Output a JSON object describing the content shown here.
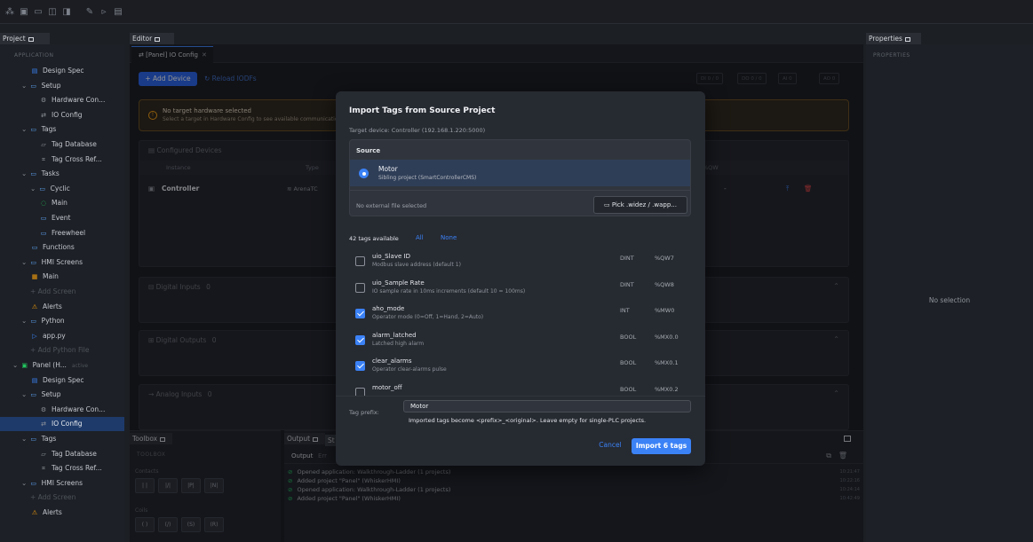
{
  "toolbar": {
    "icons": [
      "sitemap-icon",
      "new-panel-icon",
      "folder-icon",
      "save-icon",
      "save-all-icon",
      "wrench-icon",
      "run-icon",
      "window-icon"
    ]
  },
  "project": {
    "tab": "Project",
    "section": "APPLICATION",
    "tree": [
      {
        "label": "Design Spec",
        "icon": "document-icon",
        "indent": 2
      },
      {
        "label": "Setup",
        "icon": "folder-icon",
        "indent": 1,
        "chev": true
      },
      {
        "label": "Hardware Con...",
        "icon": "gear-icon",
        "indent": 3
      },
      {
        "label": "IO Config",
        "icon": "io-icon",
        "indent": 3
      },
      {
        "label": "Tags",
        "icon": "folder-icon",
        "indent": 1,
        "chev": true
      },
      {
        "label": "Tag Database",
        "icon": "tag-icon",
        "indent": 3
      },
      {
        "label": "Tag Cross Ref...",
        "icon": "crossref-icon",
        "indent": 3
      },
      {
        "label": "Tasks",
        "icon": "folder-icon",
        "indent": 1,
        "chev": true
      },
      {
        "label": "Cyclic",
        "icon": "folder-icon",
        "indent": 2,
        "chev": true
      },
      {
        "label": "Main",
        "icon": "cyclic-icon",
        "indent": 3
      },
      {
        "label": "Event",
        "icon": "folder-icon",
        "indent": 3
      },
      {
        "label": "Freewheel",
        "icon": "folder-icon",
        "indent": 3
      },
      {
        "label": "Functions",
        "icon": "folder-icon",
        "indent": 2
      },
      {
        "label": "HMI Screens",
        "icon": "folder-icon",
        "indent": 1,
        "chev": true
      },
      {
        "label": "Main",
        "icon": "screen-icon",
        "indent": 2
      },
      {
        "label": "+ Add Screen",
        "icon": "",
        "indent": 2,
        "dim": true
      },
      {
        "label": "Alerts",
        "icon": "warning-icon",
        "indent": 2
      },
      {
        "label": "Python",
        "icon": "folder-icon",
        "indent": 1,
        "chev": true
      },
      {
        "label": "app.py",
        "icon": "python-icon",
        "indent": 2
      },
      {
        "label": "+ Add Python File",
        "icon": "",
        "indent": 2,
        "dim": true
      },
      {
        "label": "Panel (H...",
        "icon": "project-icon",
        "indent": 0,
        "chev": true,
        "badge": "active"
      },
      {
        "label": "Design Spec",
        "icon": "document-icon",
        "indent": 2
      },
      {
        "label": "Setup",
        "icon": "folder-icon",
        "indent": 1,
        "chev": true
      },
      {
        "label": "Hardware Con...",
        "icon": "gear-icon",
        "indent": 3
      },
      {
        "label": "IO Config",
        "icon": "io-icon",
        "indent": 3,
        "selected": true
      },
      {
        "label": "Tags",
        "icon": "folder-icon",
        "indent": 1,
        "chev": true
      },
      {
        "label": "Tag Database",
        "icon": "tag-icon",
        "indent": 3
      },
      {
        "label": "Tag Cross Ref...",
        "icon": "crossref-icon",
        "indent": 3
      },
      {
        "label": "HMI Screens",
        "icon": "folder-icon",
        "indent": 1,
        "chev": true
      },
      {
        "label": "+ Add Screen",
        "icon": "",
        "indent": 2,
        "dim": true
      },
      {
        "label": "Alerts",
        "icon": "warning-icon",
        "indent": 2
      }
    ]
  },
  "editor": {
    "tab": "Editor",
    "doc_tab": "[Panel] IO Config",
    "add_device": "+ Add Device",
    "reload": "Reload IODFs",
    "counters": [
      "DI 0 / 0",
      "DO 0 / 0",
      "AI 0",
      "AO 0"
    ],
    "warning_title": "No target hardware selected",
    "warning_text": "Select a target in Hardware Config to see available communication",
    "configured_devices": "Configured Devices",
    "col_instance": "Instance",
    "col_type": "Type",
    "col_qw": "%QW",
    "device_name": "Controller",
    "device_type": "ArenaTC",
    "device_qw": "-",
    "digital_inputs": "Digital Inputs",
    "digital_inputs_count": "0",
    "digital_outputs": "Digital Outputs",
    "digital_outputs_count": "0",
    "analog_inputs": "Analog Inputs",
    "analog_inputs_count": "0"
  },
  "properties": {
    "tab": "Properties",
    "section": "PROPERTIES",
    "empty": "No selection"
  },
  "toolbox": {
    "tab": "Toolbox",
    "section": "TOOLBOX",
    "contacts": "Contacts",
    "contact_btns": [
      "| |",
      "|/|",
      "|P|",
      "|N|"
    ],
    "coils": "Coils",
    "coil_btns": [
      "( )",
      "(/)",
      "(S)",
      "(R)"
    ]
  },
  "output": {
    "tab": "Output",
    "tab2": "St",
    "sub_output": "Output",
    "sub_errors": "Err",
    "lines": [
      {
        "text": "Opened application: Walkthrough-Ladder (1 projects)",
        "ts": "10:21:47"
      },
      {
        "text": "Added project \"Panel\" (WhiskerHMI)",
        "ts": "10:22:16"
      },
      {
        "text": "Opened application: Walkthrough-Ladder (1 projects)",
        "ts": "10:24:14"
      },
      {
        "text": "Added project \"Panel\" (WhiskerHMI)",
        "ts": "10:42:49"
      }
    ]
  },
  "dialog": {
    "title": "Import Tags from Source Project",
    "subtitle": "Target device: Controller (192.168.1.220:5000)",
    "source_label": "Source",
    "source_name": "Motor",
    "source_desc": "Sibling project (SmartControllerCMS)",
    "no_file": "No external file selected",
    "pick_btn": "Pick .widez / .wapp...",
    "available": "42 tags available",
    "all": "All",
    "none": "None",
    "tags": [
      {
        "name": "uio_Slave ID",
        "desc": "Modbus slave address (default 1)",
        "type": "DINT",
        "addr": "%QW7",
        "checked": false
      },
      {
        "name": "uio_Sample Rate",
        "desc": "IO sample rate in 10ms increments (default 10 = 100ms)",
        "type": "DINT",
        "addr": "%QW8",
        "checked": false
      },
      {
        "name": "aho_mode",
        "desc": "Operator mode (0=Off, 1=Hand, 2=Auto)",
        "type": "INT",
        "addr": "%MW0",
        "checked": true
      },
      {
        "name": "alarm_latched",
        "desc": "Latched high alarm",
        "type": "BOOL",
        "addr": "%MX0.0",
        "checked": true
      },
      {
        "name": "clear_alarms",
        "desc": "Operator clear-alarms pulse",
        "type": "BOOL",
        "addr": "%MX0.1",
        "checked": true
      },
      {
        "name": "motor_off",
        "desc": "",
        "type": "BOOL",
        "addr": "%MX0.2",
        "checked": false
      }
    ],
    "prefix_label": "Tag prefix:",
    "prefix_value": "Motor",
    "prefix_help": "Imported tags become <prefix>_<original>. Leave empty for single-PLC projects.",
    "cancel": "Cancel",
    "import": "Import 6 tags"
  },
  "colors": {
    "accent": "#3b82f6",
    "warning": "#f59e0b",
    "success": "#22c55e",
    "danger": "#ef4444"
  }
}
